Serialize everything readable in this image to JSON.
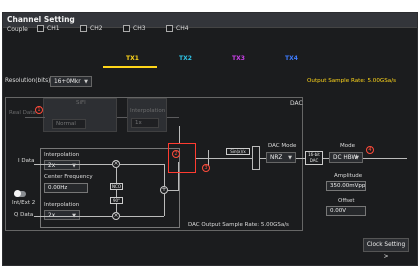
{
  "window": {
    "title": "Channel Setting"
  },
  "couple": {
    "label": "Couple",
    "options": [
      "CH1",
      "CH2",
      "CH3",
      "CH4"
    ]
  },
  "tabs": [
    {
      "label": "TX1",
      "color": "#ffd61a",
      "active": true
    },
    {
      "label": "TX2",
      "color": "#2ec3e6"
    },
    {
      "label": "TX3",
      "color": "#c940e8"
    },
    {
      "label": "TX4",
      "color": "#3d7bff"
    }
  ],
  "resolution": {
    "label": "Resolution(bits)",
    "value": "16+0Mkr"
  },
  "output_rate": "Output Sample Rate: 5.00GSa/s",
  "dac": {
    "label": "DAC",
    "real_data": "Real Data",
    "sifi": "SiFI",
    "sifi_value": "Normal",
    "interp_top": "Interpolation",
    "interp_top_value": "1x",
    "sin_x_x": "Sin(x)/x",
    "mode_label": "DAC Mode",
    "mode_value": "NRZ",
    "dac_block": "16-bit DAC",
    "output_rate": "DAC Output Sample Rate: 5.00GSa/s"
  },
  "iq": {
    "i_data": "I Data",
    "q_data": "Q Data",
    "interp_label": "Interpolation",
    "interp_value": "2x",
    "interp_q_label": "Interpolation",
    "interp_q_value": "2x",
    "center_freq_label": "Center Frequency",
    "center_freq_value": "0.00Hz",
    "nco": "NCO",
    "phase": "90°",
    "toggle_label": "Int/Ext 2"
  },
  "output": {
    "mode_label": "Mode",
    "mode_value": "DC HBW",
    "amplitude_label": "Amplitude",
    "amplitude_value": "350.00mVpp",
    "offset_label": "Offset",
    "offset_value": "0.00V"
  },
  "badges": [
    "1",
    "2",
    "3",
    "4"
  ],
  "clock_button": "Clock Setting >"
}
